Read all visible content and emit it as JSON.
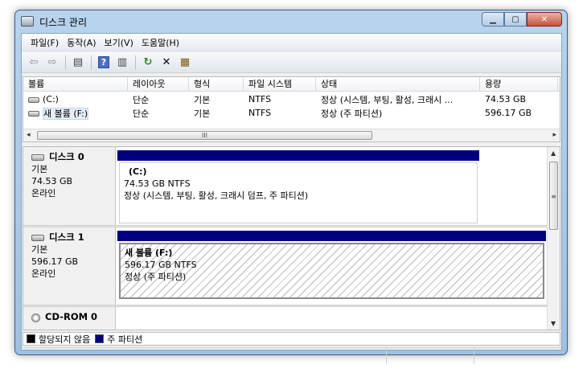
{
  "window": {
    "title": "디스크 관리"
  },
  "menu": [
    "파일(F)",
    "동작(A)",
    "보기(V)",
    "도움말(H)"
  ],
  "toolbar": {
    "back_glyph": "⇦",
    "forward_glyph": "⇨",
    "list_glyph": "▤",
    "help_glyph": "?",
    "view_glyph": "▥",
    "refresh_glyph": "↻",
    "delete_glyph": "✕",
    "properties_glyph": "▦"
  },
  "volume_list": {
    "columns": [
      "볼륨",
      "레이아웃",
      "형식",
      "파일 시스템",
      "상태",
      "용량"
    ],
    "rows": [
      {
        "volume": "(C:)",
        "layout": "단순",
        "type": "기본",
        "fs": "NTFS",
        "status": "정상 (시스템, 부팅, 활성, 크래시 ...",
        "capacity": "74.53 GB"
      },
      {
        "volume": "새 볼륨 (F:)",
        "layout": "단순",
        "type": "기본",
        "fs": "NTFS",
        "status": "정상 (주 파티션)",
        "capacity": "596.17 GB"
      }
    ],
    "scroll_thumb_grip": "III"
  },
  "disks": [
    {
      "name": "디스크 0",
      "type": "기본",
      "size": "74.53 GB",
      "state": "온라인",
      "partition": {
        "name": "(C:)",
        "size_fs": "74.53 GB NTFS",
        "status": "정상 (시스템, 부팅, 활성, 크래시 덤프, 주 파티션)"
      }
    },
    {
      "name": "디스크 1",
      "type": "기본",
      "size": "596.17 GB",
      "state": "온라인",
      "partition": {
        "name": "새 볼륨  (F:)",
        "size_fs": "596.17 GB NTFS",
        "status": "정상 (주 파티션)"
      }
    },
    {
      "name": "CD-ROM 0"
    }
  ],
  "legend": [
    {
      "label": "할당되지 않음",
      "color": "#000000"
    },
    {
      "label": "주 파티션",
      "color": "#00007f"
    }
  ],
  "vscroll_grip": "≡"
}
